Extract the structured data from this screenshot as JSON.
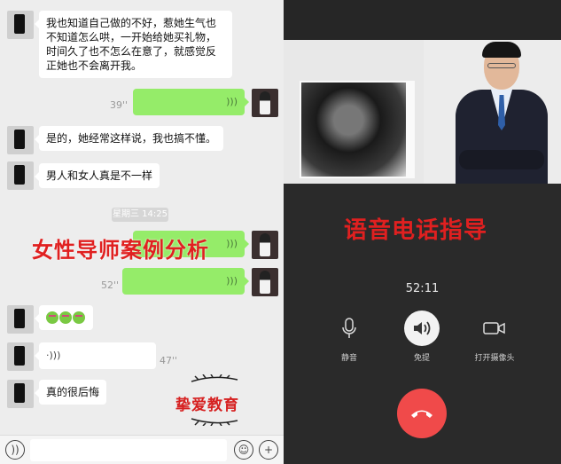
{
  "chat": {
    "messages": [
      {
        "text": "我也知道自己做的不好，惹她生气也不知道怎么哄，一开始给她买礼物，时间久了也不怎么在意了，就感觉反正她也不会离开我。"
      },
      {
        "duration": "39''"
      },
      {
        "text": "是的，她经常这样说，我也搞不懂。"
      },
      {
        "text": "男人和女人真是不一样"
      },
      {
        "duration": "52''"
      },
      {
        "duration": "47''"
      },
      {
        "text": "真的很后悔"
      }
    ],
    "timestamp": "星期三 14:25",
    "overlay_title": "女性导师案例分析",
    "logo_text": "挚爱教育"
  },
  "call": {
    "title": "语音电话指导",
    "timer": "52:11",
    "controls": [
      {
        "label": "静音",
        "icon": "microphone-icon"
      },
      {
        "label": "免提",
        "icon": "speaker-icon"
      },
      {
        "label": "打开摄像头",
        "icon": "video-camera-icon"
      }
    ],
    "hangup_color": "#f04a4a"
  },
  "colors": {
    "chat_bg": "#ededed",
    "green_bubble": "#95ec69",
    "call_bg": "#2a2a2a",
    "accent_red": "#e02020"
  }
}
